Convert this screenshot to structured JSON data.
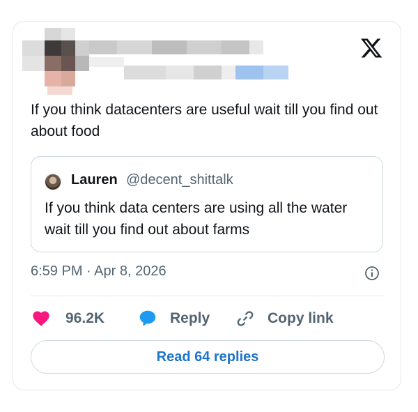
{
  "tweet": {
    "text": "If you think datacenters are useful wait till you find out about food",
    "timestamp": "6:59 PM · Apr 8, 2026"
  },
  "quote": {
    "name": "Lauren",
    "handle": "@decent_shittalk",
    "text": "If you think data centers are using all the water wait till you find out about farms"
  },
  "actions": {
    "likes": "96.2K",
    "reply_label": "Reply",
    "copy_label": "Copy link",
    "read_replies": "Read 64 replies"
  },
  "icons": [
    "x-logo-icon",
    "info-icon",
    "heart-icon",
    "reply-bubble-icon",
    "link-icon"
  ],
  "colors": {
    "heart": "#f91880",
    "reply_bubble": "#1d9bf0",
    "read_link": "#1d74c9",
    "muted": "#536471"
  }
}
